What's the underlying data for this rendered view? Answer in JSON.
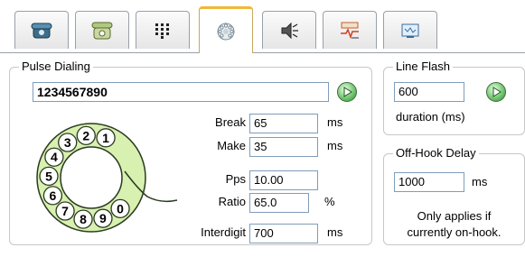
{
  "tabs": [
    {
      "name": "phone-icon",
      "active": false
    },
    {
      "name": "handset-icon",
      "active": false
    },
    {
      "name": "keypad-icon",
      "active": false
    },
    {
      "name": "rotary-dial-icon",
      "active": true
    },
    {
      "name": "speaker-icon",
      "active": false
    },
    {
      "name": "signal-icon",
      "active": false
    },
    {
      "name": "display-icon",
      "active": false
    }
  ],
  "pulse": {
    "legend": "Pulse Dialing",
    "number": "1234567890",
    "break_label": "Break",
    "break_value": "65",
    "break_unit": "ms",
    "make_label": "Make",
    "make_value": "35",
    "make_unit": "ms",
    "pps_label": "Pps",
    "pps_value": "10.00",
    "ratio_label": "Ratio",
    "ratio_value": "65.0",
    "ratio_unit": "%",
    "interdigit_label": "Interdigit",
    "interdigit_value": "700",
    "interdigit_unit": "ms",
    "dial_digits": [
      "1",
      "2",
      "3",
      "4",
      "5",
      "6",
      "7",
      "8",
      "9",
      "0"
    ]
  },
  "flash": {
    "legend": "Line Flash",
    "value": "600",
    "caption": "duration (ms)"
  },
  "offhook": {
    "legend": "Off-Hook Delay",
    "value": "1000",
    "unit": "ms",
    "note_line1": "Only applies if",
    "note_line2": "currently on-hook."
  },
  "colors": {
    "dial_fill": "#d8f0b0",
    "go_green": "#2f8a2f"
  }
}
